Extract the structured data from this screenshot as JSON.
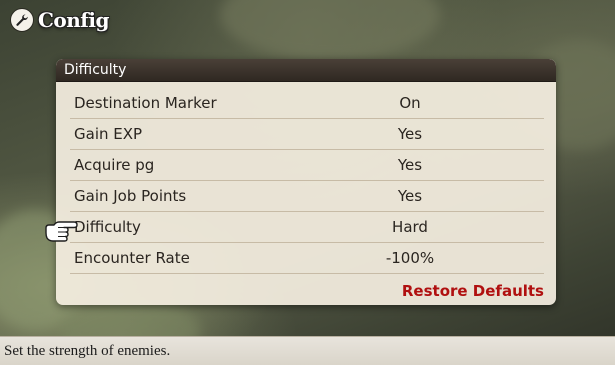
{
  "header": {
    "title": "Config",
    "icon": "wrench-icon"
  },
  "panel": {
    "title": "Difficulty",
    "rows": [
      {
        "label": "Destination Marker",
        "value": "On"
      },
      {
        "label": "Gain EXP",
        "value": "Yes"
      },
      {
        "label": "Acquire pg",
        "value": "Yes"
      },
      {
        "label": "Gain Job Points",
        "value": "Yes"
      },
      {
        "label": "Difficulty",
        "value": "Hard"
      },
      {
        "label": "Encounter Rate",
        "value": "-100%"
      }
    ],
    "restore_label": "Restore Defaults",
    "selected_row": "Difficulty"
  },
  "status": {
    "help_text": "Set the strength of enemies."
  },
  "colors": {
    "panel_header": "#3a322b",
    "restore_text": "#b01010",
    "row_text": "#2a2520"
  }
}
